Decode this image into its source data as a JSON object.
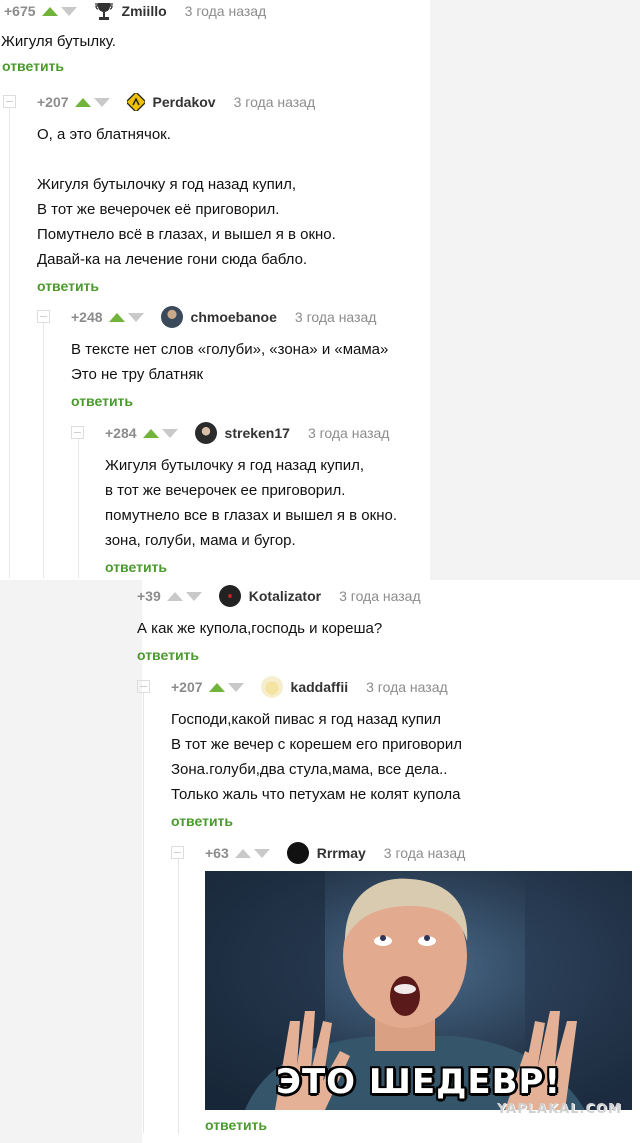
{
  "reply_label": "ответить",
  "colors": {
    "accent_green": "#71b33b",
    "reply_green": "#4a9a2c",
    "muted": "#8c8c8c",
    "disabled_arrow": "#c9c9c9"
  },
  "comments": [
    {
      "rating": "+675",
      "author": "Zmiillo",
      "avatar": "trophy-icon",
      "time": "3 года назад",
      "lines": [
        "Жигуля бутылку."
      ]
    },
    {
      "rating": "+207",
      "author": "Perdakov",
      "avatar": "warning-sign-icon",
      "time": "3 года назад",
      "lines": [
        "О, а это блатнячок.",
        "",
        "Жигуля бутылочку я год назад купил,",
        "В тот же вечерочек её приговорил.",
        "Помутнело всё в глазах, и вышел я в окно.",
        "Давай-ка на лечение гони сюда бабло."
      ]
    },
    {
      "rating": "+248",
      "author": "chmoebanoe",
      "avatar": "user-photo",
      "time": "3 года назад",
      "lines": [
        "В тексте нет слов «голуби», «зона» и «мама»",
        "Это не тру блатняк"
      ]
    },
    {
      "rating": "+284",
      "author": "streken17",
      "avatar": "user-photo",
      "time": "3 года назад",
      "lines": [
        "Жигуля бутылочку я год назад купил,",
        "в тот же вечерочек ее приговорил.",
        "помутнело все в глазах и вышел я в окно.",
        "зона, голуби, мама и бугор."
      ]
    },
    {
      "rating": "+39",
      "author": "Kotalizator",
      "avatar": "user-photo",
      "time": "3 года назад",
      "lines": [
        "А как же купола,господь и кореша?"
      ]
    },
    {
      "rating": "+207",
      "author": "kaddaffii",
      "avatar": "cartoon-face",
      "time": "3 года назад",
      "lines": [
        "Господи,какой пивас я год назад купил",
        "В тот же вечер с корешем его приговорил",
        "Зона.голуби,два стула,мама, все дела..",
        "Только жаль что петухам не колят купола"
      ]
    },
    {
      "rating": "+63",
      "author": "Rrrmay",
      "avatar": "dark-avatar",
      "time": "3 года назад",
      "lines": []
    }
  ],
  "meme": {
    "caption": "ЭТО ШЕДЕВР!",
    "watermark": "YAPLAKAL.COM"
  }
}
